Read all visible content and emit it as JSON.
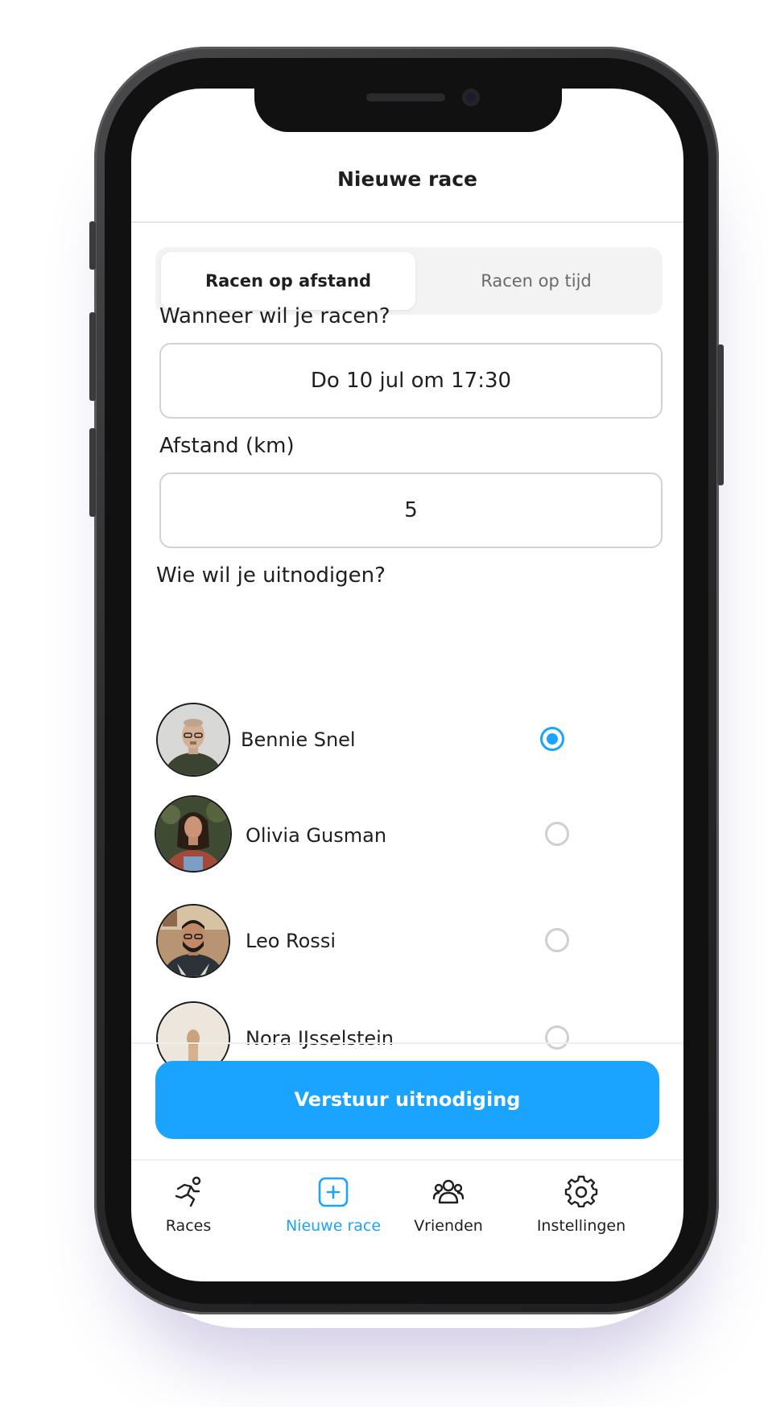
{
  "header": {
    "title": "Nieuwe race"
  },
  "segmented": {
    "options": [
      "Racen op afstand",
      "Racen op tijd"
    ],
    "selected": "Racen op afstand"
  },
  "when": {
    "label": "Wanneer wil je racen?",
    "value": "Do 10 jul om 17:30"
  },
  "distance": {
    "label": "Afstand (km)",
    "value": "5"
  },
  "invite": {
    "label": "Wie wil je uitnodigen?",
    "friends": [
      {
        "name": "Bennie Snel",
        "selected": true
      },
      {
        "name": "Olivia Gusman",
        "selected": false
      },
      {
        "name": "Leo Rossi",
        "selected": false
      },
      {
        "name": "Nora IJsselstein",
        "selected": false
      }
    ]
  },
  "send_button": {
    "label": "Verstuur uitnodiging"
  },
  "tabbar": {
    "tabs": [
      {
        "label": "Races",
        "icon": "runner-icon"
      },
      {
        "label": "Nieuwe race",
        "icon": "plus-square-icon",
        "active": true
      },
      {
        "label": "Vrienden",
        "icon": "friends-icon"
      },
      {
        "label": "Instellingen",
        "icon": "gear-icon"
      }
    ]
  },
  "colors": {
    "accent": "#1aa3ff",
    "text": "#1f1f1f",
    "muted": "#6a6a6a"
  }
}
